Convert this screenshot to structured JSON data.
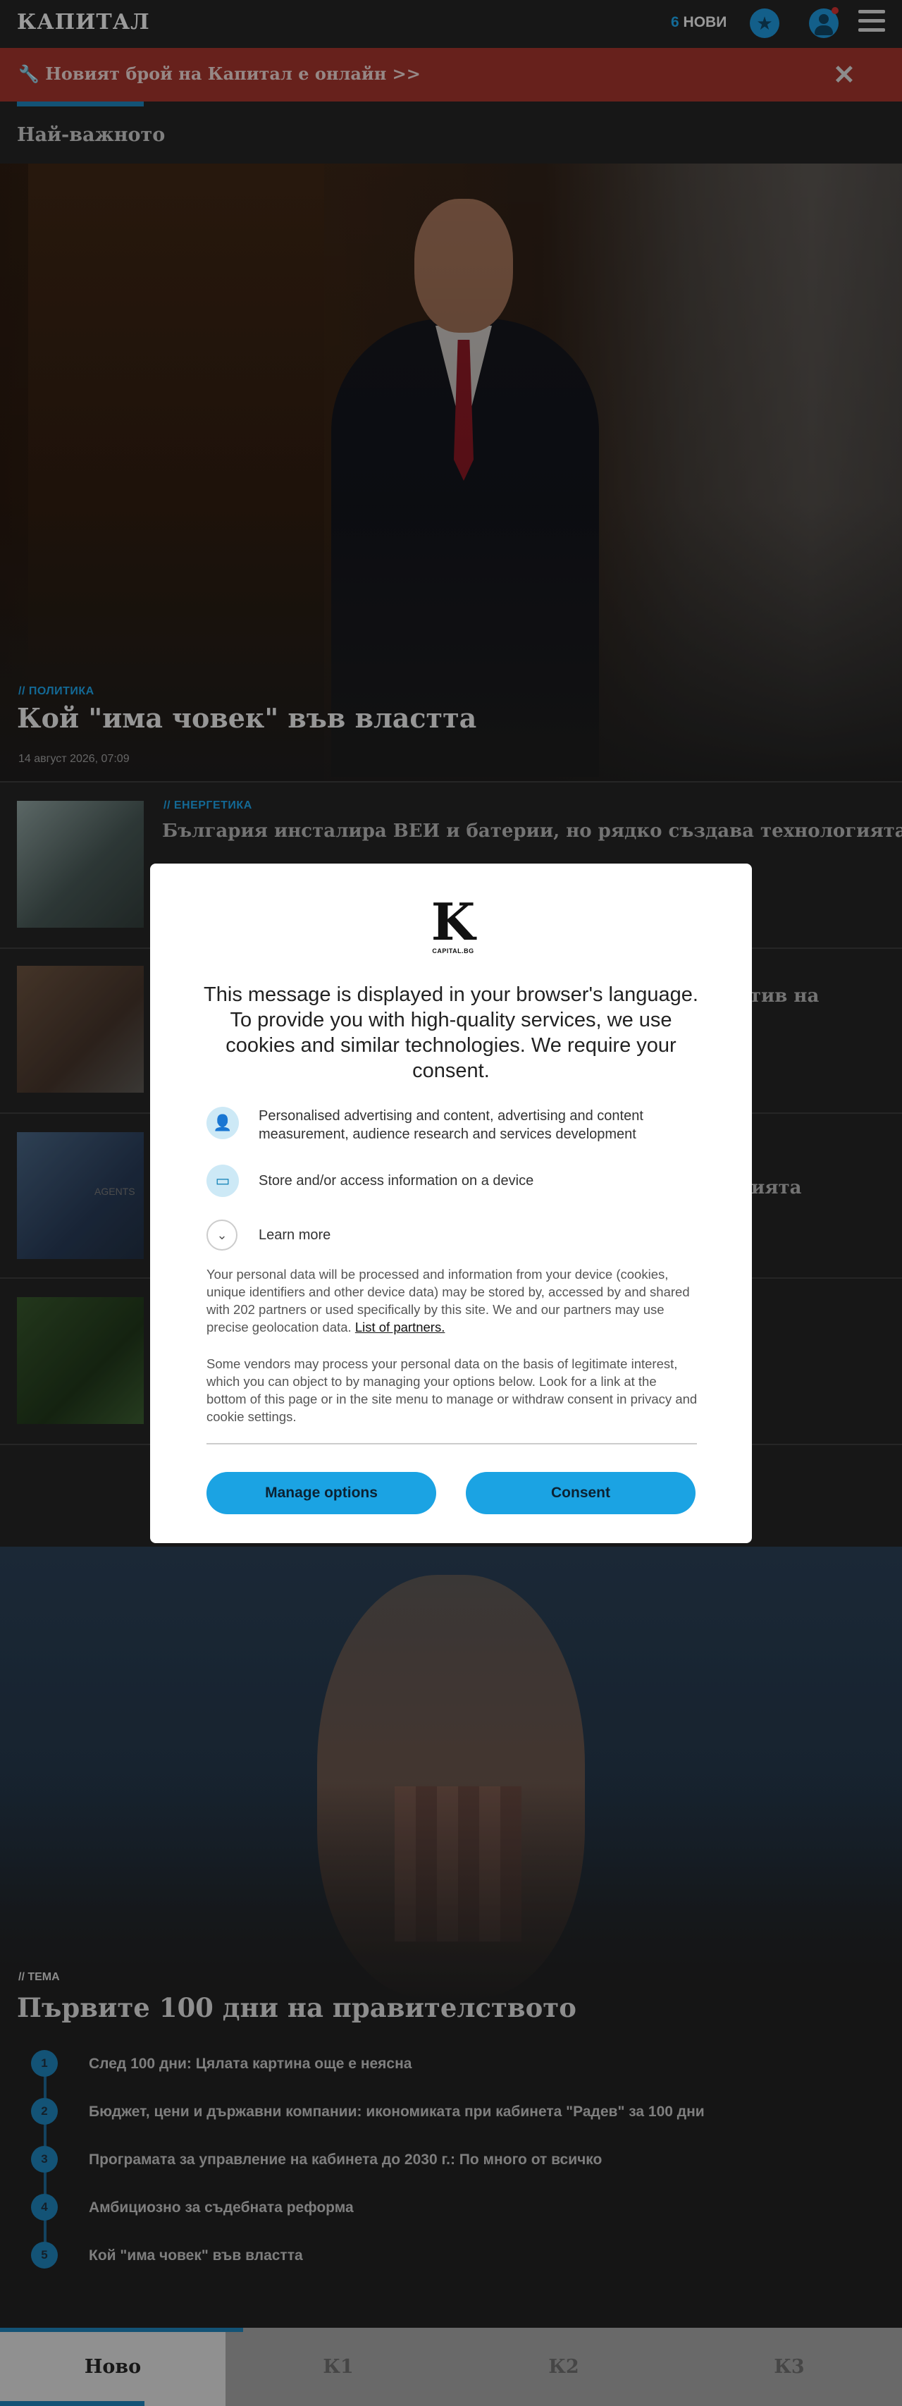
{
  "header": {
    "logo": "КАПИТАЛ",
    "news_count": "6",
    "news_label": "НОВИ"
  },
  "promo": {
    "text": "🔧 Новият брой на Капитал е онлайн >>",
    "close": "✕"
  },
  "section": {
    "title": "Най-важното"
  },
  "hero": {
    "category": "// ПОЛИТИКА",
    "title": "Кой \"има човек\" във властта",
    "date": "14 август 2026, 07:09"
  },
  "articles": [
    {
      "category": "// ЕНЕРГЕТИКА",
      "title": "България инсталира ВЕИ и батерии, но рядко създава технологията"
    },
    {
      "category": "",
      "title": "наратив на"
    },
    {
      "category": "",
      "title": "ията",
      "thumb_label": "AGENTS"
    },
    {
      "category": "",
      "title": ""
    }
  ],
  "topic": {
    "category": "// ТЕМА",
    "title": "Първите 100 дни на правителството",
    "items": [
      {
        "num": "1",
        "text": "След 100 дни: Цялата картина още е неясна"
      },
      {
        "num": "2",
        "text": "Бюджет, цени и държавни компании: икономиката при кабинета \"Радев\" за 100 дни"
      },
      {
        "num": "3",
        "text": "Програмата за управление на кабинета до 2030 г.: По много от всичко"
      },
      {
        "num": "4",
        "text": "Амбициозно за съдебната реформа"
      },
      {
        "num": "5",
        "text": "Кой \"има човек\" във властта"
      }
    ]
  },
  "tabs": [
    {
      "label": "Ново"
    },
    {
      "label": "К1"
    },
    {
      "label": "К2"
    },
    {
      "label": "К3"
    }
  ],
  "consent": {
    "logo_letter": "K",
    "logo_caption": "CAPITAL.BG",
    "heading": "This message is displayed in your browser's language. To provide you with high-quality services, we use cookies and similar technologies. We require your consent.",
    "purposes": [
      {
        "icon": "person-icon",
        "text": "Personalised advertising and content, advertising and content measurement, audience research and services development"
      },
      {
        "icon": "device-icon",
        "text": "Store and/or access information on a device"
      }
    ],
    "learn_more": "Learn more",
    "para1": "Your personal data will be processed and information from your device (cookies, unique identifiers and other device data) may be stored by, accessed by and shared with 202 partners or used specifically by this site. We and our partners may use precise geolocation data.",
    "partners_link": "List of partners.",
    "para2": "Some vendors may process your personal data on the basis of legitimate interest, which you can object to by managing your options below. Look for a link at the bottom of this page or in the site menu to manage or withdraw consent in privacy and cookie settings.",
    "manage_button": "Manage options",
    "consent_button": "Consent"
  },
  "colors": {
    "accent": "#1a8cc7",
    "promo": "#8a2d26",
    "button": "#1ba3e3"
  }
}
